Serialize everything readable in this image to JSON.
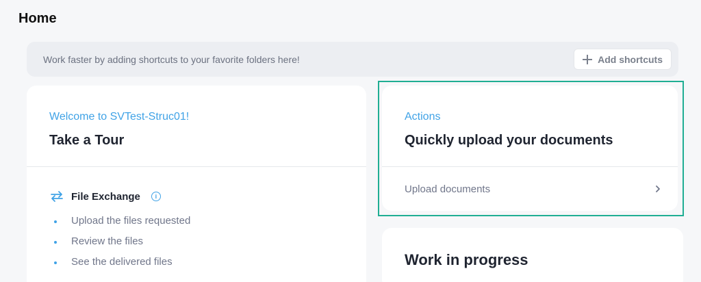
{
  "page": {
    "title": "Home"
  },
  "shortcuts": {
    "hint": "Work faster by adding shortcuts to your favorite folders here!",
    "add_label": "Add shortcuts",
    "add_icon": "plus-icon"
  },
  "tour_card": {
    "eyebrow": "Welcome to SVTest-Struc01!",
    "heading": "Take a Tour",
    "section": {
      "icon": "swap-arrows-icon",
      "title": "File Exchange",
      "info_icon": "info-icon",
      "items": [
        "Upload the files requested",
        "Review the files",
        "See the delivered files"
      ]
    }
  },
  "actions_card": {
    "eyebrow": "Actions",
    "heading": "Quickly upload your documents",
    "link_label": "Upload documents",
    "link_icon": "chevron-right-icon",
    "highlight_color": "#1fae93"
  },
  "wip_card": {
    "heading": "Work in progress"
  },
  "colors": {
    "accent": "#3fa2e6",
    "background": "#f6f7f9",
    "card": "#ffffff"
  }
}
